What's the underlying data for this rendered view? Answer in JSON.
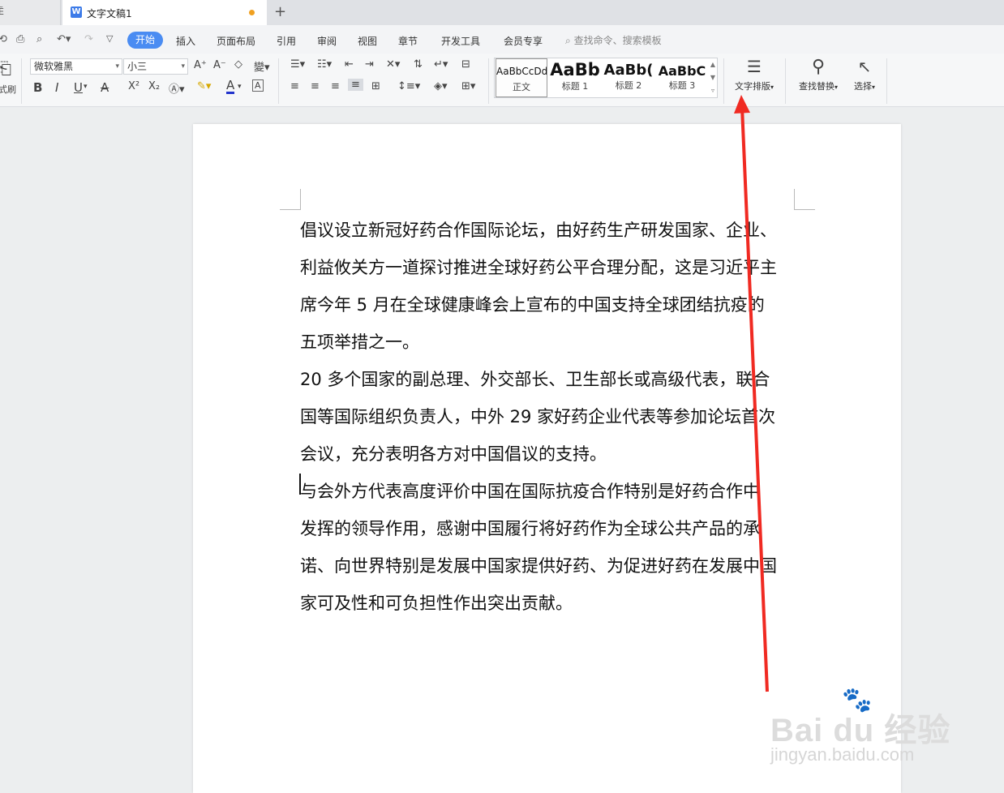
{
  "tabs": {
    "prev_label": "Ĕ",
    "active_title": "文字文稿1",
    "doc_icon": "W",
    "new_tab": "+"
  },
  "menu": {
    "items": [
      "开始",
      "插入",
      "页面布局",
      "引用",
      "审阅",
      "视图",
      "章节",
      "开发工具",
      "会员专享"
    ],
    "search": "查找命令、搜索模板"
  },
  "ribbon": {
    "format_painter": "式刷",
    "font_name": "微软雅黑",
    "font_size": "小三",
    "styles": [
      {
        "preview": "AaBbCcDd",
        "label": "正文"
      },
      {
        "preview": "AaBb",
        "label": "标题 1"
      },
      {
        "preview": "AaBb(",
        "label": "标题 2"
      },
      {
        "preview": "AaBbC",
        "label": "标题 3"
      }
    ],
    "text_layout": "文字排版",
    "find_replace": "查找替换",
    "select": "选择",
    "bold": "B",
    "italic": "I",
    "underline": "U",
    "strikethrough": "A",
    "superscript": "X²",
    "subscript": "X₂",
    "font_color": "A",
    "char_border": "A",
    "grow_font": "A⁺",
    "shrink_font": "A⁻"
  },
  "document": {
    "lines": [
      "倡议设立新冠好药合作国际论坛，由好药生产研发国家、企业、",
      "利益攸关方一道探讨推进全球好药公平合理分配，这是习近平主",
      "席今年 5 月在全球健康峰会上宣布的中国支持全球团结抗疫的",
      "五项举措之一。",
      "20 多个国家的副总理、外交部长、卫生部长或高级代表，联合",
      "国等国际组织负责人，中外 29 家好药企业代表等参加论坛首次",
      "会议，充分表明各方对中国倡议的支持。",
      "与会外方代表高度评价中国在国际抗疫合作特别是好药合作中",
      "发挥的领导作用，感谢中国履行将好药作为全球公共产品的承",
      "诺、向世界特别是发展中国家提供好药、为促进好药在发展中国",
      "家可及性和可负担性作出突出贡献。"
    ]
  },
  "annotation": {
    "color": "#f02a22"
  },
  "watermark": {
    "logo": "Bai du 经验",
    "url": "jingyan.baidu.com"
  }
}
